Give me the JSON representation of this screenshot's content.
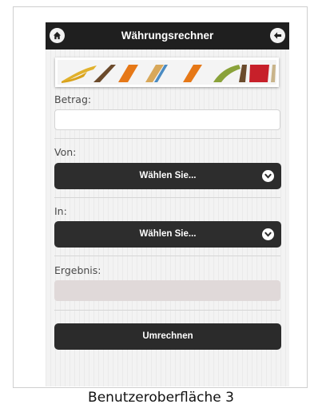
{
  "header": {
    "title": "Währungsrechner",
    "home_icon": "home-icon",
    "back_icon": "arrow-left-icon"
  },
  "form": {
    "amount_label": "Betrag:",
    "amount_value": "",
    "from_label": "Von:",
    "from_select": "Wählen Sie...",
    "to_label": "In:",
    "to_select": "Wählen Sie...",
    "result_label": "Ergebnis:",
    "result_value": "",
    "convert_button": "Umrechnen"
  },
  "caption": "Benutzeroberfläche 3",
  "colors": {
    "header": "#1f1f1f",
    "button": "#2b2b2b",
    "result_bg": "#e0d9d9"
  }
}
